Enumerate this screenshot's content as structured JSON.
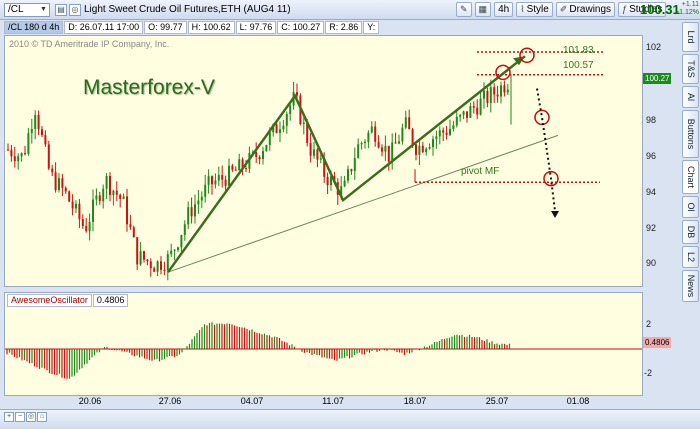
{
  "toolbar": {
    "symbol": "/CL",
    "instrument": "Light Sweet Crude Oil Futures,ETH (AUG4 11)",
    "timeframe": "4h",
    "style_label": "Style",
    "drawings_label": "Drawings",
    "studies_label": "Studies",
    "last_price": "100.31",
    "change_1": "+1.11",
    "change_2": "+1.12%"
  },
  "infobar": {
    "sym": "/CL 180 d 4h",
    "date": "D: 26.07.11 17:00",
    "open": "O: 99.77",
    "high": "H: 100.62",
    "low": "L: 97.76",
    "close": "C: 100.27",
    "range": "R: 2.86",
    "y": "Y:"
  },
  "chart": {
    "watermark": "2010 © TD Ameritrade IP Company, Inc.",
    "brand": "Masterforex-V",
    "pivot_label": "pivot МF",
    "level_1": "101.83",
    "level_2": "100.57",
    "current_tag": "100.27",
    "y_ticks": [
      "102",
      "100",
      "98",
      "96",
      "94",
      "92",
      "90"
    ],
    "osc_ticks": [
      "2",
      "0",
      "-2"
    ],
    "osc_tag": "0.4806",
    "x_ticks": [
      "20.06",
      "27.06",
      "04.07",
      "11.07",
      "18.07",
      "25.07",
      "01.08"
    ]
  },
  "oscillator": {
    "name": "AwesomeOscillator",
    "value": "0.4806"
  },
  "side_tabs": [
    "Lrd",
    "T&S",
    "Al",
    "Buttons",
    "Chart",
    "Ol",
    "DB",
    "L2",
    "News"
  ],
  "colors": {
    "up": "#1c8a1c",
    "down": "#c81414",
    "bg": "#fffee0",
    "trend": "#3c6e1e"
  },
  "chart_data": {
    "type": "candlestick",
    "symbol": "/CL",
    "timeframe": "4h",
    "ylim": [
      89,
      102.5
    ],
    "key_prices": {
      "high": 100.62,
      "low": 97.76,
      "close": 100.27,
      "open": 99.77
    },
    "levels": [
      101.83,
      100.57
    ],
    "x": [
      "20.06",
      "27.06",
      "04.07",
      "11.07",
      "18.07",
      "25.07",
      "01.08"
    ]
  }
}
